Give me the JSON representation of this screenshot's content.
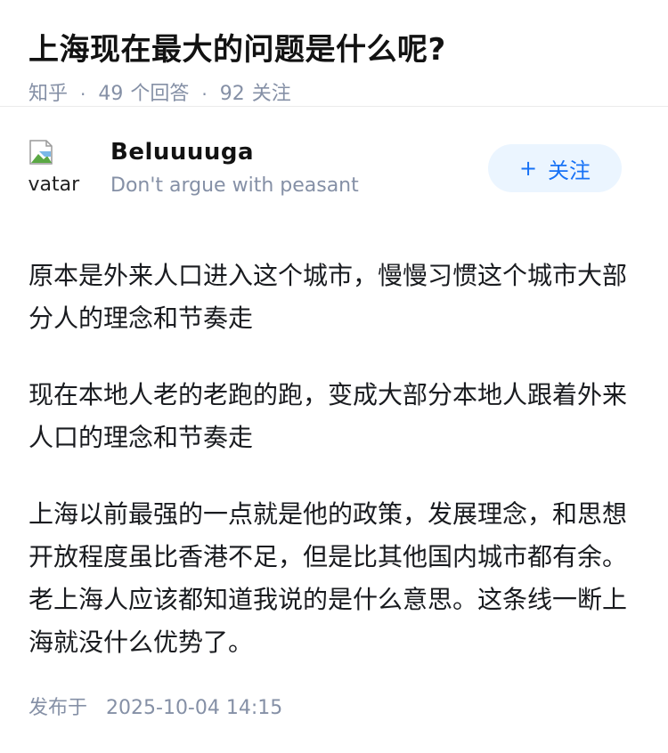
{
  "question": {
    "title": "上海现在最大的问题是什么呢?",
    "source": "知乎",
    "answer_count": "49",
    "answer_label": "个回答",
    "follower_count": "92",
    "follower_label": "关注",
    "separator": "·"
  },
  "author": {
    "avatar_alt": "avatar",
    "name": "Beluuuuga",
    "bio": "Don't argue with peasant",
    "follow_plus": "+",
    "follow_label": "关注"
  },
  "answer": {
    "paragraphs": [
      "原本是外来人口进入这个城市，慢慢习惯这个城市大部分人的理念和节奏走",
      "现在本地人老的老跑的跑，变成大部分本地人跟着外来人口的理念和节奏走",
      "上海以前最强的一点就是他的政策，发展理念，和思想开放程度虽比香港不足，但是比其他国内城市都有余。老上海人应该都知道我说的是什么意思。这条线一断上海就没什么优势了。"
    ],
    "publish_label": "发布于",
    "publish_time": "2025-10-04 14:15"
  },
  "colors": {
    "meta_gray": "#8590a6",
    "accent_blue": "#1772f6",
    "follow_bg": "#ebf5ff"
  }
}
